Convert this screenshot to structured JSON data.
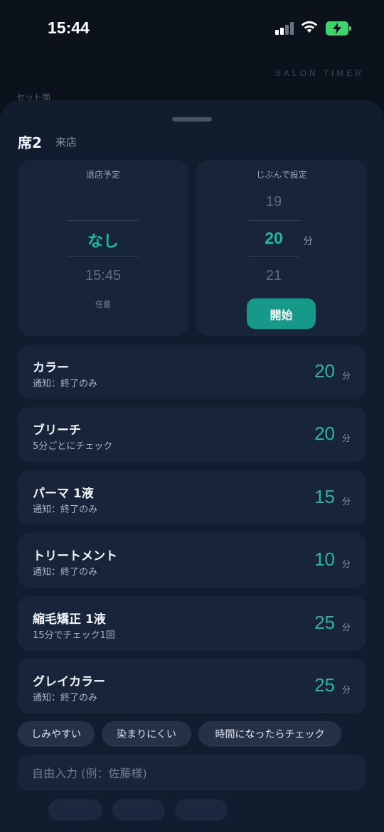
{
  "status_bar": {
    "time": "15:44"
  },
  "background": {
    "brand": "SALON TIMER",
    "label": "セット面"
  },
  "sheet": {
    "seat_title": "席2",
    "seat_subtitle": "来店",
    "checkout": {
      "heading": "退店予定",
      "selected": "なし",
      "next": "15:45",
      "note": "任意"
    },
    "custom": {
      "heading": "じぶんで設定",
      "prev": "19",
      "selected": "20",
      "next": "21",
      "unit": "分",
      "start_label": "開始"
    },
    "presets": [
      {
        "name": "カラー",
        "note": "通知：終了のみ",
        "minutes": "20",
        "unit": "分"
      },
      {
        "name": "ブリーチ",
        "note": "5分ごとにチェック",
        "minutes": "20",
        "unit": "分"
      },
      {
        "name": "パーマ 1液",
        "note": "通知：終了のみ",
        "minutes": "15",
        "unit": "分"
      },
      {
        "name": "トリートメント",
        "note": "通知：終了のみ",
        "minutes": "10",
        "unit": "分"
      },
      {
        "name": "縮毛矯正 1液",
        "note": "15分でチェック1回",
        "minutes": "25",
        "unit": "分"
      },
      {
        "name": "グレイカラー",
        "note": "通知：終了のみ",
        "minutes": "25",
        "unit": "分"
      }
    ],
    "chips": [
      "しみやすい",
      "染まりにくい",
      "時間になったらチェック"
    ],
    "free_input": {
      "placeholder": "自由入力 (例：佐藤様)",
      "value": ""
    }
  },
  "colors": {
    "accent": "#22b8a0",
    "button": "#17998a",
    "card": "#18243a",
    "sheet": "#111c2e"
  }
}
